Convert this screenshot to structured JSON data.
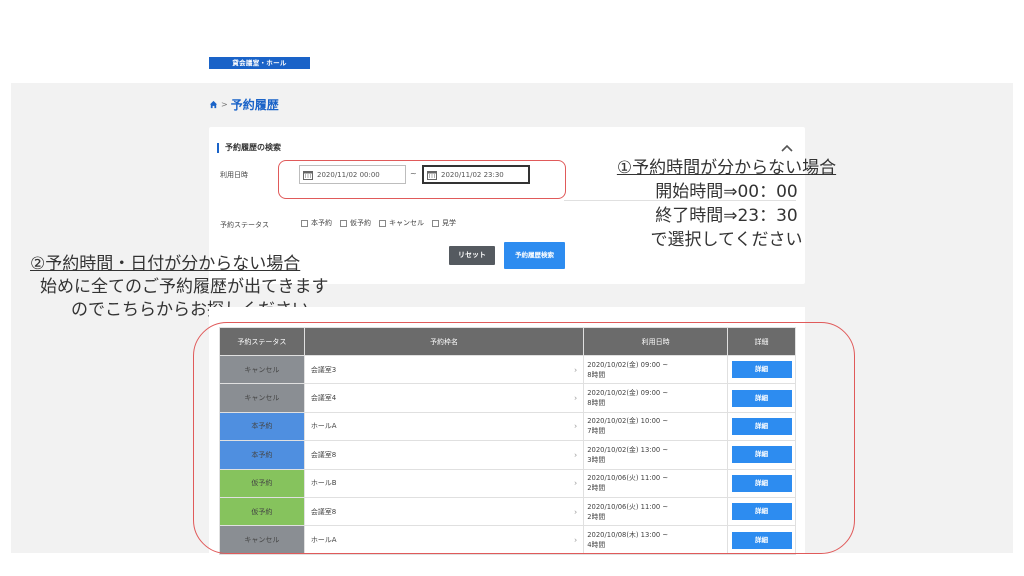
{
  "header": {
    "logo_text": "貸会議室・ホール"
  },
  "breadcrumb": {
    "title": "予約履歴"
  },
  "search": {
    "heading": "予約履歴の検索",
    "date_label": "利用日時",
    "date_from": "2020/11/02 00:00",
    "date_sep": "~",
    "date_to": "2020/11/02 23:30",
    "status_label": "予約ステータス",
    "status_options": [
      "本予約",
      "仮予約",
      "キャンセル",
      "見学"
    ],
    "reset_label": "リセット",
    "search_label": "予約履歴検索"
  },
  "annotations": {
    "note1": {
      "title": "①予約時間が分からない場合",
      "line1": "開始時間⇒00：00",
      "line2": "終了時間⇒23：30",
      "line3": "で選択してください"
    },
    "note2": {
      "title": "②予約時間・日付が分からない場合",
      "line1": "始めに全てのご予約履歴が出てきます",
      "line2": "のでこちらからお探しください"
    }
  },
  "table": {
    "headers": [
      "予約ステータス",
      "予約枠名",
      "利用日時",
      "詳細"
    ],
    "rows": [
      {
        "status": "キャンセル",
        "status_kind": "cancel",
        "name": "会議室3",
        "date": "2020/10/02(金) 09:00 ~",
        "duration": "8時間",
        "detail": "詳細"
      },
      {
        "status": "キャンセル",
        "status_kind": "cancel",
        "name": "会議室4",
        "date": "2020/10/02(金) 09:00 ~",
        "duration": "8時間",
        "detail": "詳細"
      },
      {
        "status": "本予約",
        "status_kind": "main",
        "name": "ホールA",
        "date": "2020/10/02(金) 10:00 ~",
        "duration": "7時間",
        "detail": "詳細"
      },
      {
        "status": "本予約",
        "status_kind": "main",
        "name": "会議室8",
        "date": "2020/10/02(金) 13:00 ~",
        "duration": "3時間",
        "detail": "詳細"
      },
      {
        "status": "仮予約",
        "status_kind": "temp",
        "name": "ホールB",
        "date": "2020/10/06(火) 11:00 ~",
        "duration": "2時間",
        "detail": "詳細"
      },
      {
        "status": "仮予約",
        "status_kind": "temp",
        "name": "会議室8",
        "date": "2020/10/06(火) 11:00 ~",
        "duration": "2時間",
        "detail": "詳細"
      },
      {
        "status": "キャンセル",
        "status_kind": "cancel",
        "name": "ホールA",
        "date": "2020/10/08(木) 13:00 ~",
        "duration": "4時間",
        "detail": "詳細"
      }
    ]
  },
  "colors": {
    "accent": "#1a63c8",
    "button_blue": "#2d8cf0",
    "status_cancel": "#8a8e93",
    "status_main": "#4f8fe0",
    "status_temp": "#86c35d",
    "annotation_outline": "#e05a5a"
  }
}
